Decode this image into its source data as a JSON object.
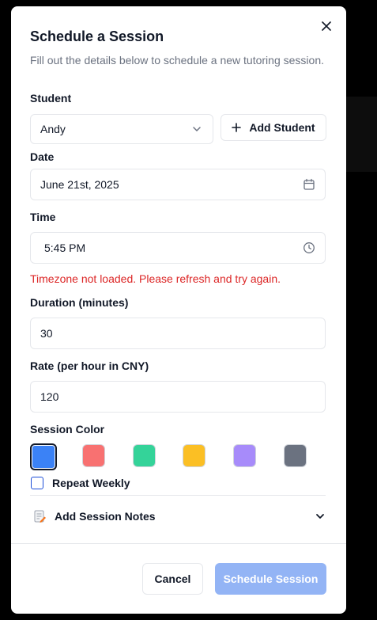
{
  "dialog": {
    "title": "Schedule a Session",
    "subtitle": "Fill out the details below to schedule a new tutoring session."
  },
  "student": {
    "label": "Student",
    "selected": "Andy",
    "add_label": "Add Student"
  },
  "date": {
    "label": "Date",
    "value": "June 21st, 2025"
  },
  "time": {
    "label": "Time",
    "value": "5:45 PM",
    "error": "Timezone not loaded. Please refresh and try again."
  },
  "duration": {
    "label": "Duration (minutes)",
    "value": "30"
  },
  "rate": {
    "label": "Rate (per hour in CNY)",
    "value": "120"
  },
  "session_color": {
    "label": "Session Color",
    "options": [
      "#3b82f6",
      "#f87171",
      "#34d399",
      "#fbbf24",
      "#a78bfa",
      "#6b7280"
    ],
    "selected": "#3b82f6"
  },
  "repeat": {
    "label": "Repeat Weekly",
    "checked": false
  },
  "notes": {
    "label": "Add Session Notes"
  },
  "actions": {
    "cancel": "Cancel",
    "submit": "Schedule Session"
  }
}
